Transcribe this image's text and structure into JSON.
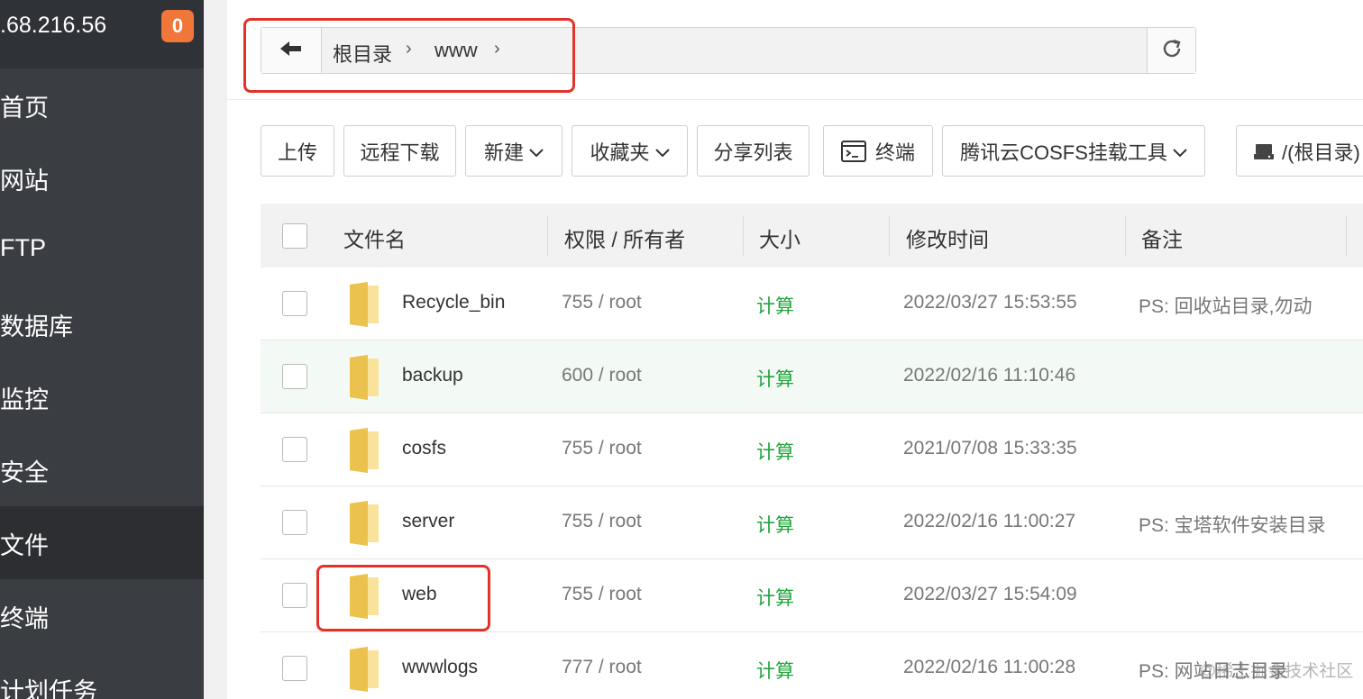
{
  "sidebar": {
    "ip": ".68.216.56",
    "badge": "0",
    "items": [
      {
        "label": "首页"
      },
      {
        "label": "网站"
      },
      {
        "label": "FTP"
      },
      {
        "label": "数据库"
      },
      {
        "label": "监控"
      },
      {
        "label": "安全"
      },
      {
        "label": "文件"
      },
      {
        "label": "终端"
      },
      {
        "label": "计划任务"
      }
    ],
    "active_index": 6
  },
  "pathbar": {
    "crumbs": [
      "根目录",
      "www"
    ]
  },
  "toolbar": {
    "upload": "上传",
    "remote_download": "远程下载",
    "new": "新建",
    "favorites": "收藏夹",
    "share_list": "分享列表",
    "terminal": "终端",
    "cosfs": "腾讯云COSFS挂载工具",
    "disk": "/(根目录)"
  },
  "table": {
    "headers": {
      "name": "文件名",
      "perm": "权限 / 所有者",
      "size": "大小",
      "mtime": "修改时间",
      "note": "备注"
    },
    "rows": [
      {
        "name": "Recycle_bin",
        "perm": "755 / root",
        "size": "计算",
        "mtime": "2022/03/27 15:53:55",
        "note": "PS: 回收站目录,勿动"
      },
      {
        "name": "backup",
        "perm": "600 / root",
        "size": "计算",
        "mtime": "2022/02/16 11:10:46",
        "note": ""
      },
      {
        "name": "cosfs",
        "perm": "755 / root",
        "size": "计算",
        "mtime": "2021/07/08 15:33:35",
        "note": ""
      },
      {
        "name": "server",
        "perm": "755 / root",
        "size": "计算",
        "mtime": "2022/02/16 11:00:27",
        "note": "PS: 宝塔软件安装目录"
      },
      {
        "name": "web",
        "perm": "755 / root",
        "size": "计算",
        "mtime": "2022/03/27 15:54:09",
        "note": ""
      },
      {
        "name": "wwwlogs",
        "perm": "777 / root",
        "size": "计算",
        "mtime": "2022/02/16 11:00:28",
        "note": "PS: 网站日志目录"
      }
    ]
  },
  "watermark": "@稀土掘金技术社区",
  "colors": {
    "sidebar_bg": "#3a3d42",
    "badge": "#f0763a",
    "accent_green": "#20a53a",
    "highlight_red": "#e2322a",
    "folder": "#f5d26b"
  }
}
